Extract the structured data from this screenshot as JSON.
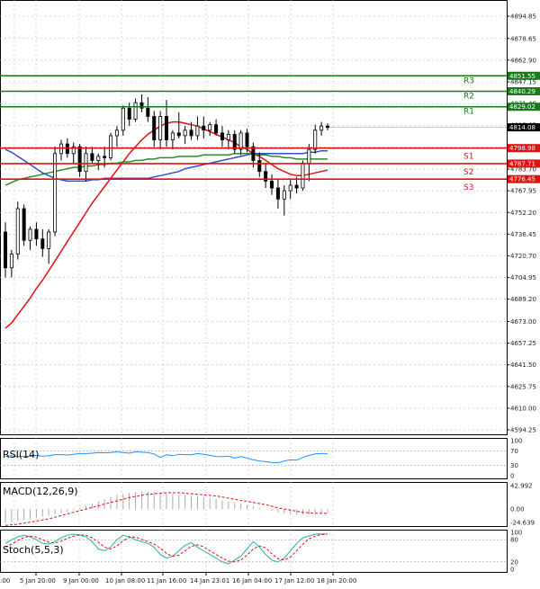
{
  "chart_data": {
    "type": "candlestick",
    "x_labels": [
      "5 Jan 20:00",
      "9 Jan 00:00",
      "10 Jan 08:00",
      "11 Jan 16:00",
      "14 Jan 23:01",
      "16 Jan 04:00",
      "17 Jan 12:00",
      "18 Jan 20:00"
    ],
    "x_label_partial": ":00",
    "price_ticks": [
      4894.85,
      4878.65,
      4862.9,
      4847.15,
      4831.4,
      4815.65,
      4799.9,
      4783.7,
      4767.95,
      4752.2,
      4736.45,
      4720.7,
      4704.95,
      4689.2,
      4673.0,
      4657.25,
      4641.5,
      4625.75,
      4610.0,
      4594.25
    ],
    "ylim": [
      4594.25,
      4902.0
    ],
    "last_price": {
      "label": "4814.08",
      "value": 4814.08
    },
    "levels": [
      {
        "name": "R3",
        "label": "4851.55",
        "value": 4851.55,
        "color": "#1a7a1a"
      },
      {
        "name": "R2",
        "label": "4840.29",
        "value": 4840.29,
        "color": "#1a7a1a"
      },
      {
        "name": "R1",
        "label": "4829.02",
        "value": 4829.02,
        "color": "#1a7a1a"
      },
      {
        "name": "S1",
        "label": "4798.98",
        "value": 4798.98,
        "color": "#e01010"
      },
      {
        "name": "S2",
        "label": "4787.71",
        "value": 4787.71,
        "color": "#e01010"
      },
      {
        "name": "S3",
        "label": "4776.45",
        "value": 4776.45,
        "color": "#e01010"
      }
    ],
    "ohlc": [
      [
        4738,
        4745,
        4705,
        4712
      ],
      [
        4712,
        4725,
        4705,
        4722
      ],
      [
        4722,
        4760,
        4718,
        4755
      ],
      [
        4755,
        4758,
        4728,
        4732
      ],
      [
        4732,
        4742,
        4725,
        4740
      ],
      [
        4740,
        4745,
        4728,
        4733
      ],
      [
        4733,
        4740,
        4720,
        4726
      ],
      [
        4726,
        4740,
        4715,
        4738
      ],
      [
        4738,
        4800,
        4735,
        4795
      ],
      [
        4795,
        4805,
        4790,
        4802
      ],
      [
        4802,
        4806,
        4792,
        4795
      ],
      [
        4795,
        4803,
        4788,
        4800
      ],
      [
        4800,
        4802,
        4778,
        4782
      ],
      [
        4782,
        4800,
        4775,
        4795
      ],
      [
        4795,
        4800,
        4788,
        4790
      ],
      [
        4790,
        4795,
        4783,
        4793
      ],
      [
        4793,
        4800,
        4785,
        4792
      ],
      [
        4792,
        4810,
        4790,
        4808
      ],
      [
        4808,
        4815,
        4800,
        4812
      ],
      [
        4812,
        4830,
        4808,
        4828
      ],
      [
        4828,
        4832,
        4815,
        4820
      ],
      [
        4820,
        4835,
        4818,
        4832
      ],
      [
        4832,
        4838,
        4825,
        4828
      ],
      [
        4828,
        4836,
        4818,
        4822
      ],
      [
        4822,
        4826,
        4800,
        4805
      ],
      [
        4805,
        4826,
        4798,
        4822
      ],
      [
        4822,
        4834,
        4800,
        4805
      ],
      [
        4805,
        4812,
        4798,
        4810
      ],
      [
        4810,
        4825,
        4806,
        4808
      ],
      [
        4808,
        4815,
        4802,
        4812
      ],
      [
        4812,
        4818,
        4805,
        4808
      ],
      [
        4808,
        4822,
        4805,
        4815
      ],
      [
        4815,
        4822,
        4806,
        4812
      ],
      [
        4812,
        4818,
        4808,
        4816
      ],
      [
        4816,
        4820,
        4808,
        4810
      ],
      [
        4810,
        4815,
        4800,
        4805
      ],
      [
        4805,
        4812,
        4798,
        4809
      ],
      [
        4809,
        4812,
        4795,
        4798
      ],
      [
        4798,
        4812,
        4794,
        4810
      ],
      [
        4810,
        4813,
        4796,
        4800
      ],
      [
        4800,
        4803,
        4785,
        4790
      ],
      [
        4790,
        4796,
        4778,
        4782
      ],
      [
        4782,
        4788,
        4770,
        4775
      ],
      [
        4775,
        4780,
        4765,
        4770
      ],
      [
        4770,
        4776,
        4755,
        4762
      ],
      [
        4762,
        4772,
        4750,
        4768
      ],
      [
        4768,
        4776,
        4762,
        4772
      ],
      [
        4772,
        4778,
        4766,
        4770
      ],
      [
        4770,
        4790,
        4768,
        4788
      ],
      [
        4788,
        4802,
        4775,
        4798
      ],
      [
        4798,
        4816,
        4795,
        4812
      ],
      [
        4812,
        4818,
        4808,
        4815
      ],
      [
        4815,
        4817,
        4812,
        4814
      ]
    ],
    "ma_series": [
      {
        "color": "#e01010",
        "values": [
          4668,
          4672,
          4678,
          4684,
          4690,
          4697,
          4703,
          4710,
          4717,
          4724,
          4731,
          4738,
          4745,
          4752,
          4759,
          4765,
          4771,
          4777,
          4783,
          4789,
          4795,
          4800,
          4805,
          4809,
          4812,
          4815,
          4817,
          4818,
          4818,
          4817,
          4816,
          4815,
          4813,
          4811,
          4809,
          4807,
          4805,
          4803,
          4800,
          4798,
          4795,
          4793,
          4790,
          4787,
          4784,
          4782,
          4780,
          4779,
          4779,
          4780,
          4781,
          4782,
          4783
        ]
      },
      {
        "color": "#2e8b2e",
        "values": [
          4772,
          4774,
          4776,
          4777,
          4778,
          4779,
          4780,
          4781,
          4782,
          4783,
          4784,
          4785,
          4785,
          4786,
          4786,
          4787,
          4787,
          4788,
          4788,
          4789,
          4789,
          4790,
          4790,
          4791,
          4791,
          4792,
          4792,
          4792,
          4793,
          4793,
          4793,
          4793,
          4794,
          4794,
          4794,
          4794,
          4794,
          4795,
          4795,
          4795,
          4795,
          4794,
          4794,
          4793,
          4793,
          4792,
          4792,
          4791,
          4791,
          4791,
          4791,
          4791,
          4791
        ]
      },
      {
        "color": "#2f4fd0",
        "values": [
          4798,
          4796,
          4793,
          4790,
          4787,
          4784,
          4781,
          4779,
          4777,
          4776,
          4775,
          4775,
          4775,
          4775,
          4776,
          4776,
          4777,
          4777,
          4777,
          4777,
          4777,
          4777,
          4777,
          4777,
          4778,
          4779,
          4780,
          4781,
          4782,
          4784,
          4785,
          4786,
          4787,
          4788,
          4789,
          4790,
          4791,
          4792,
          4793,
          4794,
          4795,
          4795,
          4795,
          4795,
          4795,
          4795,
          4795,
          4795,
          4795,
          4796,
          4796,
          4797,
          4797
        ]
      }
    ],
    "rsi": {
      "label": "RSI(14)",
      "ticks": [
        100,
        70,
        30,
        0
      ],
      "values": [
        55,
        57,
        54,
        56,
        55,
        58,
        56,
        57,
        60,
        60,
        59,
        61,
        63,
        63,
        64,
        66,
        65,
        66,
        68,
        66,
        64,
        68,
        67,
        66,
        62,
        52,
        60,
        57,
        61,
        60,
        60,
        63,
        61,
        58,
        55,
        54,
        56,
        50,
        55,
        50,
        45,
        42,
        40,
        38,
        37,
        42,
        45,
        44,
        52,
        58,
        62,
        63,
        63
      ]
    },
    "macd": {
      "label": "MACD(12,26,9)",
      "ticks": [
        "42.992",
        "0.00",
        "-24.639"
      ],
      "hist": [
        -26,
        -24,
        -22,
        -20,
        -18,
        -16,
        -14,
        -12,
        -10,
        -8,
        -5,
        -2,
        2,
        6,
        10,
        14,
        18,
        22,
        26,
        28,
        30,
        31,
        32,
        32,
        31,
        30,
        29,
        28,
        27,
        26,
        25,
        24,
        22,
        20,
        18,
        16,
        14,
        12,
        10,
        8,
        5,
        2,
        0,
        -3,
        -6,
        -8,
        -9,
        -10,
        -10,
        -10,
        -9,
        -8,
        -7
      ],
      "signal": [
        -30,
        -29,
        -28,
        -26,
        -24,
        -22,
        -20,
        -18,
        -15,
        -12,
        -9,
        -6,
        -3,
        0,
        3,
        6,
        9,
        12,
        15,
        18,
        21,
        23,
        25,
        27,
        28,
        29,
        30,
        30,
        30,
        29,
        28,
        27,
        26,
        25,
        24,
        22,
        20,
        18,
        16,
        14,
        12,
        10,
        8,
        5,
        2,
        0,
        -2,
        -4,
        -6,
        -7,
        -8,
        -8,
        -8
      ]
    },
    "stoch": {
      "label": "Stoch(5,5,3)",
      "ticks": [
        100,
        80,
        20,
        0
      ],
      "k": [
        70,
        80,
        88,
        92,
        88,
        80,
        70,
        68,
        75,
        85,
        92,
        95,
        93,
        88,
        75,
        55,
        50,
        60,
        80,
        92,
        88,
        80,
        75,
        70,
        60,
        40,
        30,
        35,
        50,
        65,
        72,
        60,
        50,
        40,
        30,
        20,
        15,
        25,
        35,
        55,
        75,
        60,
        40,
        25,
        20,
        30,
        50,
        70,
        85,
        90,
        95,
        96,
        95
      ],
      "d": [
        60,
        68,
        78,
        86,
        90,
        87,
        80,
        73,
        71,
        76,
        84,
        90,
        93,
        92,
        85,
        73,
        60,
        55,
        63,
        77,
        87,
        87,
        81,
        75,
        68,
        57,
        43,
        35,
        38,
        50,
        62,
        66,
        61,
        50,
        40,
        30,
        22,
        20,
        25,
        38,
        55,
        63,
        58,
        42,
        28,
        25,
        33,
        50,
        68,
        82,
        90,
        94,
        95
      ]
    }
  }
}
